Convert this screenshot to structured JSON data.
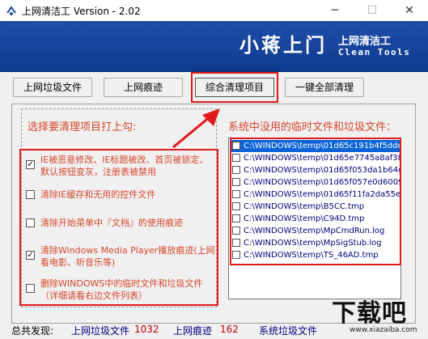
{
  "window": {
    "title": "上网清洁工 Version - 2.02",
    "minimize_glyph": "─",
    "maximize_glyph": "☐",
    "close_glyph": "✕"
  },
  "banner": {
    "big_text": "小蒋上门",
    "cn_name": "上网清洁工",
    "en_name": "Clean Tools"
  },
  "tabs": [
    {
      "label": "上网垃圾文件"
    },
    {
      "label": "上网痕迹"
    },
    {
      "label": "综合清理项目"
    },
    {
      "label": "一键全部清理"
    }
  ],
  "left_panel": {
    "heading": "选择要清理项目打上勾:",
    "options": [
      {
        "label": "IE被恶意修改、IE标题被改、首页被锁定、默认按钮变灰，注册表被禁用",
        "checked": true
      },
      {
        "label": "清除IE缓存和无用的控件文件",
        "checked": false
      },
      {
        "label": "清除开始菜单中『文档』的使用痕迹",
        "checked": false
      },
      {
        "label": "清除Windows Media Player播放痕迹(上网看电影、听音乐等)",
        "checked": true
      },
      {
        "label": "删除WINDOWS中的临时文件和垃圾文件（详细请看右边文件列表）",
        "checked": false
      }
    ]
  },
  "right_panel": {
    "heading": "系统中没用的临时文件和垃圾文件：",
    "files": [
      "C:\\WINDOWS\\temp\\01d65c191b4f5dde",
      "C:\\WINDOWS\\temp\\01d65e7745a8af38",
      "C:\\WINDOWS\\temp\\01d65f053da1b64c",
      "C:\\WINDOWS\\temp\\01d65f057e0d6009",
      "C:\\WINDOWS\\temp\\01d65f11fa2da55e",
      "C:\\WINDOWS\\temp\\B5CC.tmp",
      "C:\\WINDOWS\\temp\\C94D.tmp",
      "C:\\WINDOWS\\temp\\MpCmdRun.log",
      "C:\\WINDOWS\\temp\\MpSigStub.log",
      "C:\\WINDOWS\\temp\\TS_46AD.tmp"
    ]
  },
  "status": {
    "label": "总共发现:",
    "items": [
      {
        "name": "上网垃圾文件",
        "count": "1032"
      },
      {
        "name": "上网痕迹",
        "count": "162"
      },
      {
        "name": "系统垃圾文件",
        "count": ""
      }
    ]
  },
  "watermark": {
    "big": "下载吧",
    "small": "www.xiazaiba.com"
  },
  "colors": {
    "banner_blue": "#1f4fa8",
    "highlight_red": "#e21a1a",
    "label_orange": "#d6452a",
    "file_blue": "#000080"
  }
}
